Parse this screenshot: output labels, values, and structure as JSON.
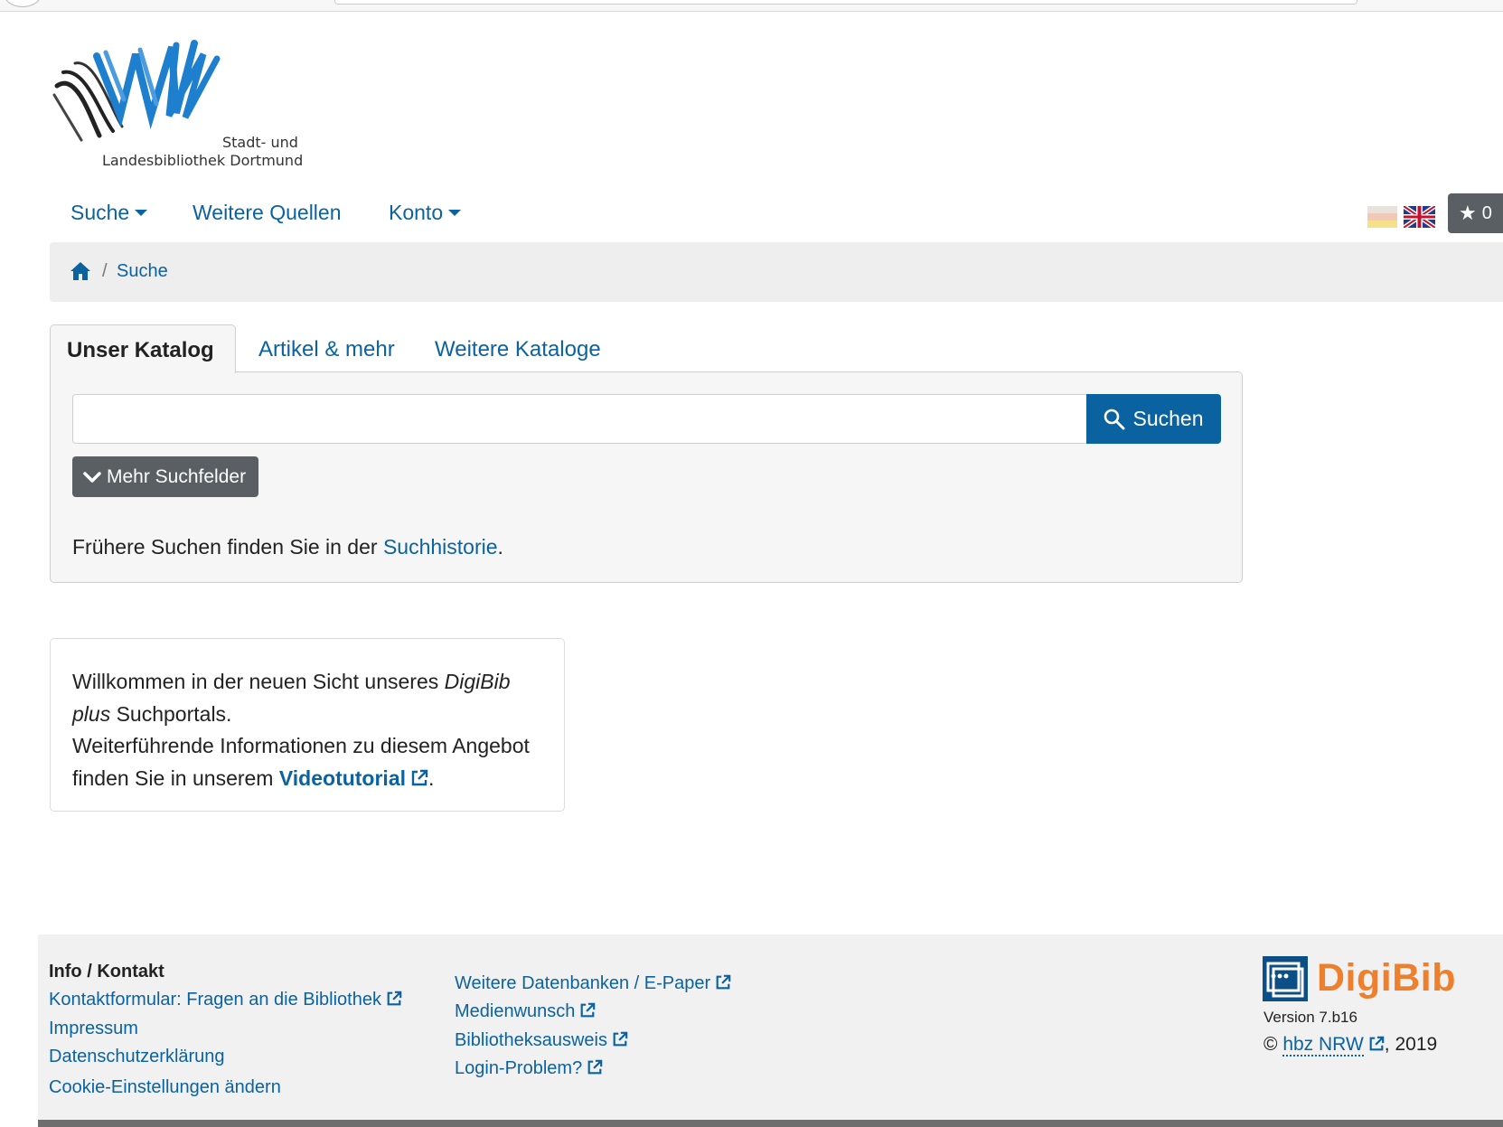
{
  "logo": {
    "line1": "Stadt- und",
    "line2": "Landesbibliothek Dortmund"
  },
  "nav": {
    "suche": "Suche",
    "weitere_quellen": "Weitere Quellen",
    "konto": "Konto",
    "watchlist_count": "0"
  },
  "breadcrumb": {
    "separator": "/",
    "current": "Suche"
  },
  "tabs": {
    "active": "Unser Katalog",
    "tab2": "Artikel & mehr",
    "tab3": "Weitere Kataloge"
  },
  "search": {
    "value": "",
    "button": "Suchen",
    "more_fields": "Mehr Suchfelder",
    "history_prefix": "Frühere Suchen finden Sie in der ",
    "history_link": "Suchhistorie",
    "history_suffix": "."
  },
  "welcome": {
    "text1": "Willkommen in der neuen Sicht unseres ",
    "brand_italic_1": "DigiBib",
    "brand_italic_2": "plus",
    "text2": " Suchportals.",
    "text3": "Weiterführende Informationen zu diesem Angebot finden Sie in unserem ",
    "link": "Videotutorial",
    "text4": "."
  },
  "footer": {
    "heading": "Info / Kontakt",
    "col1": [
      "Kontaktformular: Fragen an die Bibliothek",
      "Impressum",
      "Datenschutzerklärung",
      "Cookie-Einstellungen ändern"
    ],
    "col2": [
      "Weitere Datenbanken / E-Paper",
      "Medienwunsch",
      "Bibliotheksausweis",
      "Login-Problem?"
    ],
    "brand": "DigiBib",
    "version": "Version 7.b16",
    "copyright_symbol": "©",
    "org": "hbz NRW",
    "year": ", 2019"
  },
  "colors": {
    "link": "#0b62a1",
    "button_dark": "#5a5f64",
    "digibib_orange": "#ee7f2d",
    "panel_bg": "#f6f6f6"
  }
}
